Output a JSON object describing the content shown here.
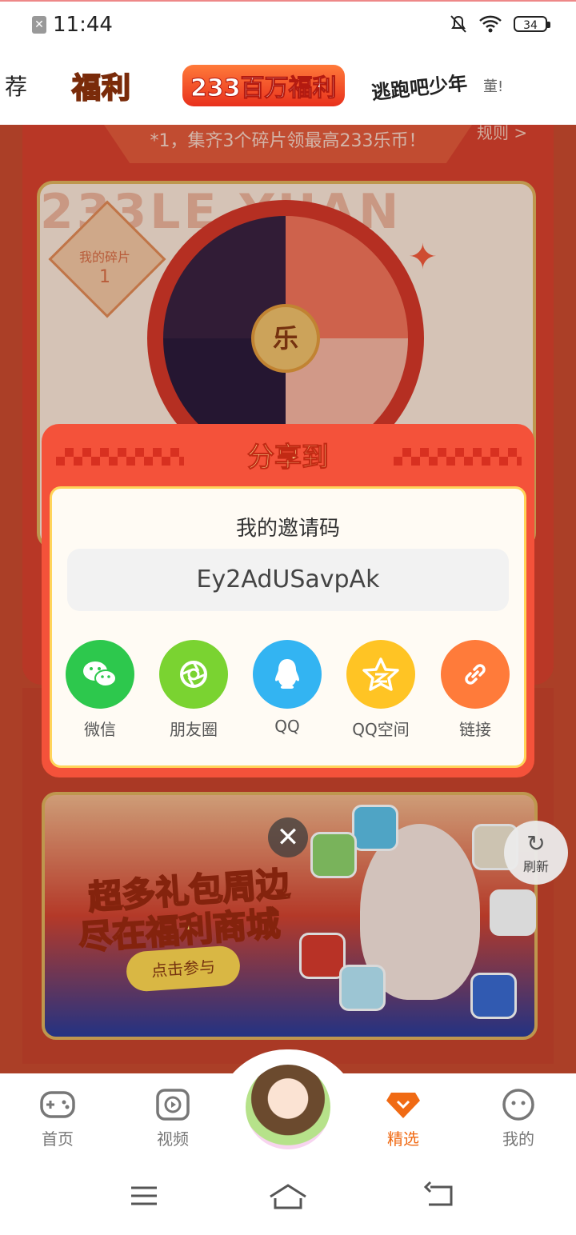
{
  "status_bar": {
    "time": "11:44",
    "battery": "34",
    "icons": [
      "notification-icon",
      "mute-icon",
      "wifi-icon",
      "battery-icon"
    ]
  },
  "top_tabs": {
    "partial_tab": "荐",
    "tab_fuli": "福利",
    "tab_233": "233百万福利",
    "tab_taopao": "逃跑吧少年",
    "tab_partial": "董!"
  },
  "background": {
    "banner_text": "*1，集齐3个碎片领最高233乐币！",
    "rules_link": "规则 >",
    "wheel_watermark": "233LE YUAN",
    "piece_label": "我的碎片",
    "piece_count": "1",
    "wheel_center": "乐",
    "mall_title_line1": "超多礼包周边",
    "mall_title_line2": "尽在福利商城",
    "mall_button": "点击参与",
    "refresh_label": "刷新"
  },
  "share_dialog": {
    "title": "分享到",
    "invite_label": "我的邀请码",
    "invite_code": "Ey2AdUSavpAk",
    "options": [
      {
        "label": "微信",
        "icon": "wechat-icon",
        "color": "#2dc84d"
      },
      {
        "label": "朋友圈",
        "icon": "moments-icon",
        "color": "#7ad331"
      },
      {
        "label": "QQ",
        "icon": "qq-icon",
        "color": "#33b4f2"
      },
      {
        "label": "QQ空间",
        "icon": "qzone-icon",
        "color": "#ffc424"
      },
      {
        "label": "链接",
        "icon": "link-icon",
        "color": "#ff7b3a"
      }
    ],
    "close_icon": "close-icon"
  },
  "bottom_nav": {
    "items": [
      {
        "label": "首页",
        "icon": "gamepad-icon",
        "active": false
      },
      {
        "label": "视频",
        "icon": "video-play-icon",
        "active": false
      },
      {
        "label": "精选",
        "icon": "gem-icon",
        "active": true
      },
      {
        "label": "我的",
        "icon": "face-icon",
        "active": false
      }
    ],
    "accent_color": "#f06a14"
  },
  "system_nav": [
    "menu-icon",
    "home-icon",
    "back-icon"
  ]
}
